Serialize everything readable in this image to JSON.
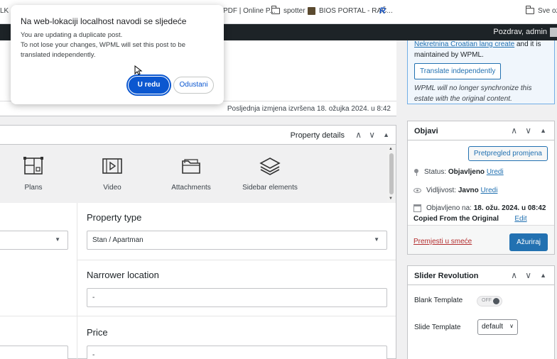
{
  "bookmarks": [
    {
      "label": "LK"
    },
    {
      "label": "PDF | Online P..."
    },
    {
      "label": "spotter",
      "icon": "folder-icon"
    },
    {
      "label": "BIOS PORTAL - RAČ...",
      "icon": "bios-icon"
    },
    {
      "label": "R",
      "icon": "r-icon"
    },
    {
      "label": "Sve ozn",
      "icon": "folder-icon"
    }
  ],
  "adminbar": {
    "greeting": "Pozdrav, admin"
  },
  "editor": {
    "last_edit": "Posljednja izmjena izvršena 18. ožujka 2024. u 8:42"
  },
  "property_details": {
    "title": "Property details",
    "tabs": [
      {
        "label": "Plans",
        "icon": "plans-icon"
      },
      {
        "label": "Video",
        "icon": "video-icon"
      },
      {
        "label": "Attachments",
        "icon": "folder-icon"
      },
      {
        "label": "Sidebar elements",
        "icon": "layers-icon"
      }
    ],
    "fields": {
      "property_type": {
        "label": "Property type",
        "value": "Stan / Apartman"
      },
      "narrower_location": {
        "label": "Narrower location",
        "value": "-"
      },
      "price": {
        "label": "Price",
        "value": "-"
      }
    }
  },
  "wpml": {
    "link_text": "Nekretnina Croatian lang create",
    "text_after_link": " and it is",
    "text_line2": "maintained by WPML.",
    "button": "Translate independently",
    "note": "WPML will no longer synchronize this estate with the original content."
  },
  "publish": {
    "title": "Objavi",
    "preview_button": "Pretpregled promjena",
    "status_label": "Status: ",
    "status_value": "Objavljeno",
    "status_edit": "Uredi",
    "visibility_label": "Vidljivost: ",
    "visibility_value": "Javno",
    "visibility_edit": "Uredi",
    "published_label": "Objavljeno na: ",
    "published_value": "18. ožu. 2024. u 08:42",
    "copied_label": "Copied From the Original",
    "copied_edit": "Edit",
    "trash": "Premjesti u smeće",
    "update_button": "Ažuriraj"
  },
  "slider": {
    "title": "Slider Revolution",
    "blank_template_label": "Blank Template",
    "toggle_text": "OFF",
    "slide_template_label": "Slide Template",
    "slide_template_value": "default"
  },
  "dialog": {
    "title": "Na web-lokaciji localhost navodi se sljedeće",
    "message_line1": "You are updating a duplicate post.",
    "message_line2": "To not lose your changes, WPML will set this post to be translated independently.",
    "ok": "U redu",
    "cancel": "Odustani"
  },
  "colors": {
    "wp_blue": "#2271b1",
    "chrome_blue": "#0b57d0",
    "admin_bar": "#1d2327",
    "trash_red": "#b32d2e"
  }
}
